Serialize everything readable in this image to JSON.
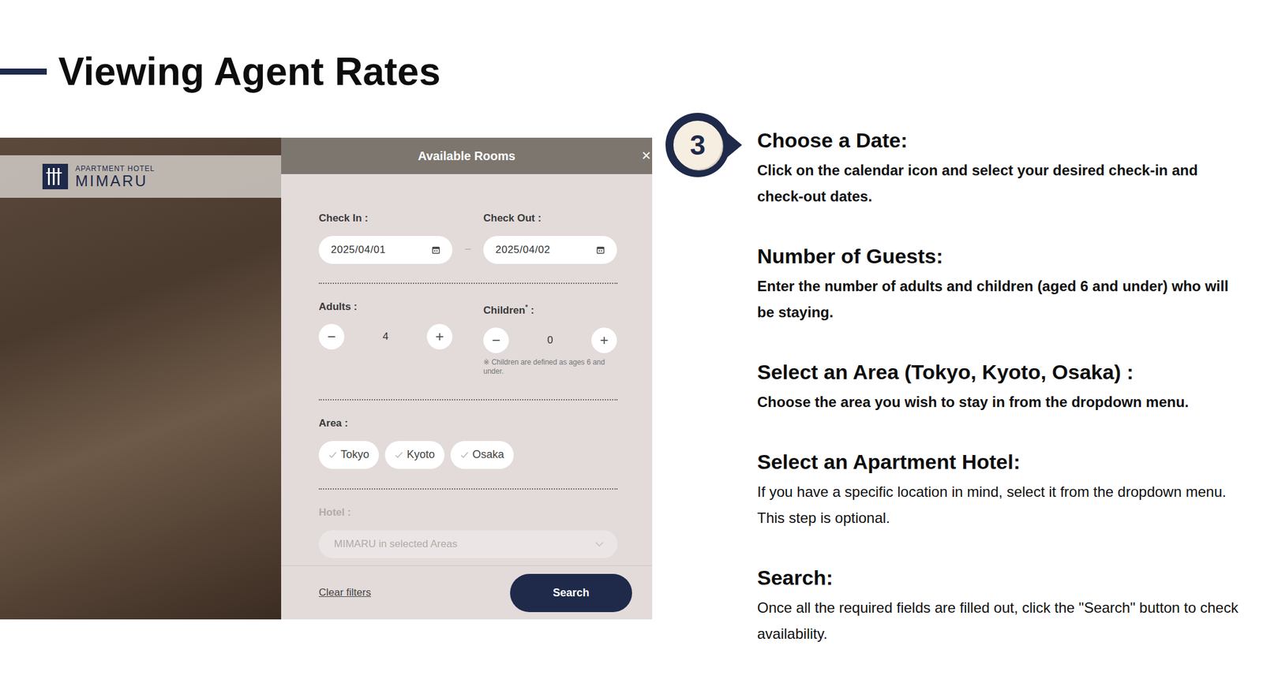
{
  "slide": {
    "title": "Viewing Agent Rates"
  },
  "screenshot": {
    "logo": {
      "line1": "APARTMENT HOTEL",
      "line2": "MIMARU"
    },
    "modal": {
      "title": "Available Rooms",
      "close": "×",
      "check_in": {
        "label": "Check In :",
        "value": "2025/04/01"
      },
      "separator": "–",
      "check_out": {
        "label": "Check Out :",
        "value": "2025/04/02"
      },
      "adults": {
        "label": "Adults :",
        "value": "4",
        "minus": "−",
        "plus": "+"
      },
      "children": {
        "label": "Children",
        "mark": "*",
        "suffix": " :",
        "value": "0",
        "minus": "−",
        "plus": "+",
        "note": "※ Children are defined as ages 6 and under."
      },
      "area": {
        "label": "Area :",
        "options": [
          {
            "label": "Tokyo",
            "selected": false
          },
          {
            "label": "Kyoto",
            "selected": false
          },
          {
            "label": "Osaka",
            "selected": false
          }
        ]
      },
      "hotel": {
        "label": "Hotel :",
        "placeholder": "MIMARU in selected Areas",
        "disabled": true
      },
      "clear": "Clear filters",
      "search": "Search"
    }
  },
  "step_badge": "3",
  "steps": [
    {
      "heading": "Choose a Date:",
      "body": "Click on the calendar icon and select your desired check-in and check-out dates.",
      "bold": true
    },
    {
      "heading": "Number of Guests:",
      "body": "Enter the number of adults and children (aged 6 and under) who will be staying.",
      "bold": true
    },
    {
      "heading": "Select an Area (Tokyo, Kyoto, Osaka) :",
      "body": "Choose the area you wish to stay in from the dropdown menu.",
      "bold": true
    },
    {
      "heading": "Select an Apartment Hotel:",
      "body": "If you have a specific location in mind, select it from the dropdown menu. This step is optional.",
      "bold": false
    },
    {
      "heading": "Search:",
      "body": "Once all the required fields are filled out, click the \"Search\" button to check availability.",
      "bold": false
    }
  ]
}
